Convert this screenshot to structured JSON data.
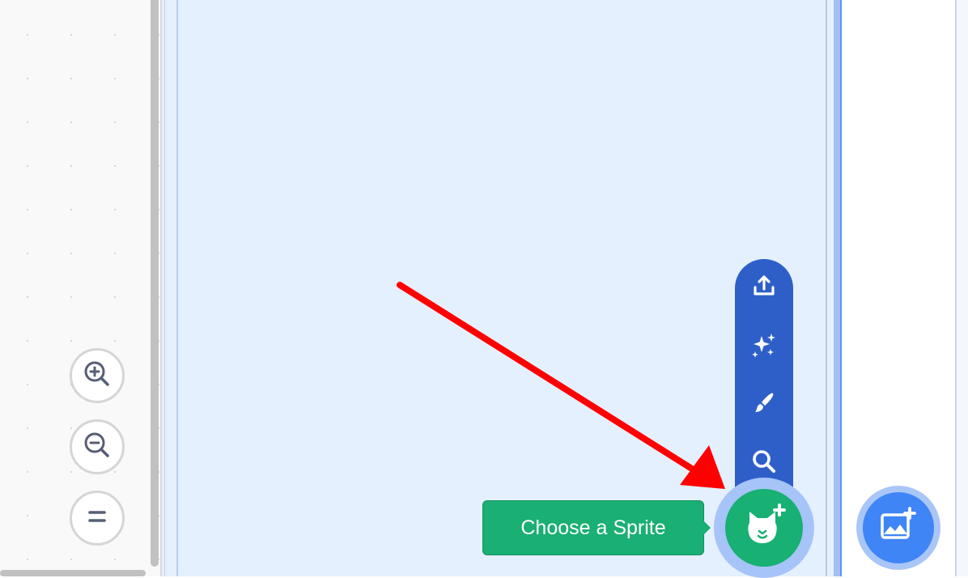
{
  "workspace": {
    "zoom_in_icon": "zoom-in-icon",
    "zoom_out_icon": "zoom-out-icon",
    "reset_zoom_icon": "equals-icon"
  },
  "sprite_menu": {
    "items": [
      {
        "icon": "upload-icon"
      },
      {
        "icon": "sparkle-icon"
      },
      {
        "icon": "paintbrush-icon"
      },
      {
        "icon": "search-icon"
      }
    ]
  },
  "sprite_button": {
    "icon": "cat-plus-icon",
    "tooltip": "Choose a Sprite"
  },
  "backdrop_button": {
    "icon": "image-plus-icon"
  },
  "colors": {
    "menu_blue": "#2e5fc9",
    "sprite_green": "#18b073",
    "backdrop_blue": "#4085f6",
    "pane_bg": "#e5f0ff",
    "annotation_red": "#ff0000"
  }
}
